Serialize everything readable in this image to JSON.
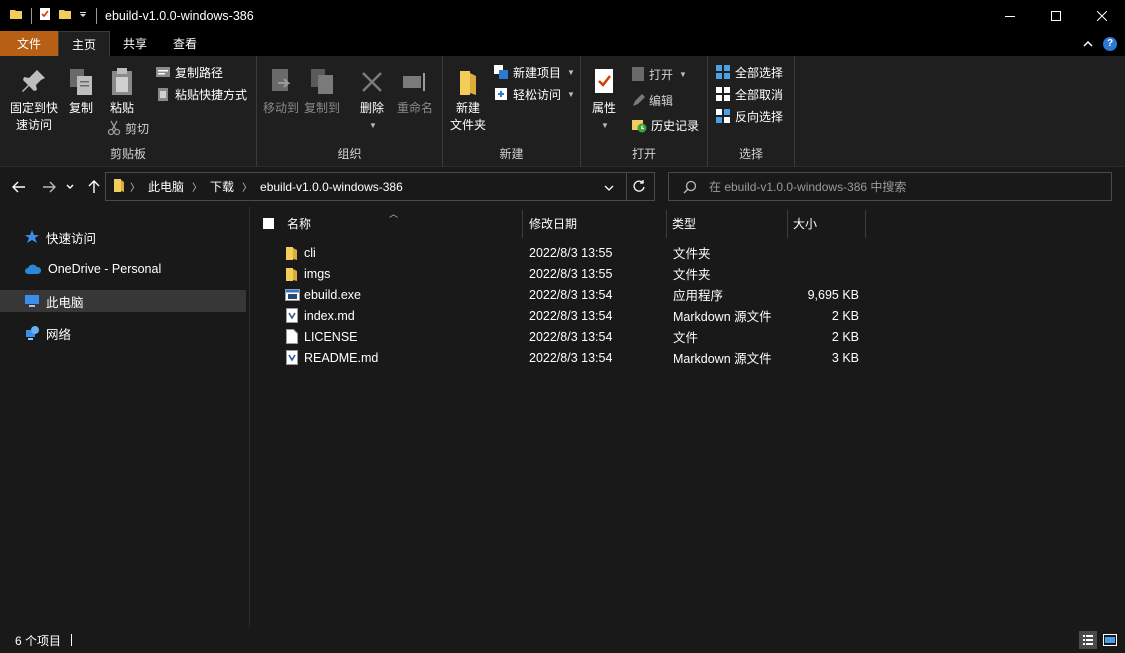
{
  "window": {
    "title": "ebuild-v1.0.0-windows-386",
    "minimize_icon": "minimize-icon",
    "maximize_icon": "maximize-icon",
    "close_icon": "close-icon"
  },
  "tabs": [
    {
      "label": "文件"
    },
    {
      "label": "主页"
    },
    {
      "label": "共享"
    },
    {
      "label": "查看"
    }
  ],
  "ribbon": {
    "clipboard": {
      "label": "剪贴板",
      "pin_quick_access": "固定到快\n速访问",
      "copy": "复制",
      "paste": "粘贴",
      "copy_path": "复制路径",
      "paste_shortcut": "粘贴快捷方式",
      "cut": "剪切"
    },
    "organize": {
      "label": "组织",
      "move_to": "移动到",
      "copy_to": "复制到",
      "delete": "删除",
      "rename": "重命名"
    },
    "new": {
      "label": "新建",
      "new_folder": "新建\n文件夹",
      "new_item": "新建项目",
      "easy_access": "轻松访问"
    },
    "open": {
      "label": "打开",
      "properties": "属性",
      "open": "打开",
      "edit": "编辑",
      "history": "历史记录"
    },
    "select": {
      "label": "选择",
      "select_all": "全部选择",
      "select_none": "全部取消",
      "invert": "反向选择"
    }
  },
  "address": {
    "crumbs": [
      "此电脑",
      "下载",
      "ebuild-v1.0.0-windows-386"
    ]
  },
  "search": {
    "placeholder": "在 ebuild-v1.0.0-windows-386 中搜索"
  },
  "navpane": {
    "items": [
      {
        "label": "快速访问",
        "icon": "star-icon"
      },
      {
        "label": "OneDrive - Personal",
        "icon": "cloud-icon"
      },
      {
        "label": "此电脑",
        "icon": "computer-icon"
      },
      {
        "label": "网络",
        "icon": "network-icon"
      }
    ]
  },
  "filelist": {
    "columns": {
      "name": "名称",
      "date": "修改日期",
      "type": "类型",
      "size": "大小"
    },
    "rows": [
      {
        "name": "cli",
        "date": "2022/8/3 13:55",
        "type": "文件夹",
        "size": "",
        "icon": "folder-icon"
      },
      {
        "name": "imgs",
        "date": "2022/8/3 13:55",
        "type": "文件夹",
        "size": "",
        "icon": "folder-icon"
      },
      {
        "name": "ebuild.exe",
        "date": "2022/8/3 13:54",
        "type": "应用程序",
        "size": "9,695 KB",
        "icon": "exe-icon"
      },
      {
        "name": "index.md",
        "date": "2022/8/3 13:54",
        "type": "Markdown 源文件",
        "size": "2 KB",
        "icon": "markdown-file-icon"
      },
      {
        "name": "LICENSE",
        "date": "2022/8/3 13:54",
        "type": "文件",
        "size": "2 KB",
        "icon": "file-icon"
      },
      {
        "name": "README.md",
        "date": "2022/8/3 13:54",
        "type": "Markdown 源文件",
        "size": "3 KB",
        "icon": "markdown-file-icon"
      }
    ]
  },
  "statusbar": {
    "count": "6 个项目"
  },
  "colors": {
    "accent_file_tab": "#b75f15",
    "folder": "#f3cc5a",
    "help": "#2b79d0",
    "background": "#191919"
  }
}
